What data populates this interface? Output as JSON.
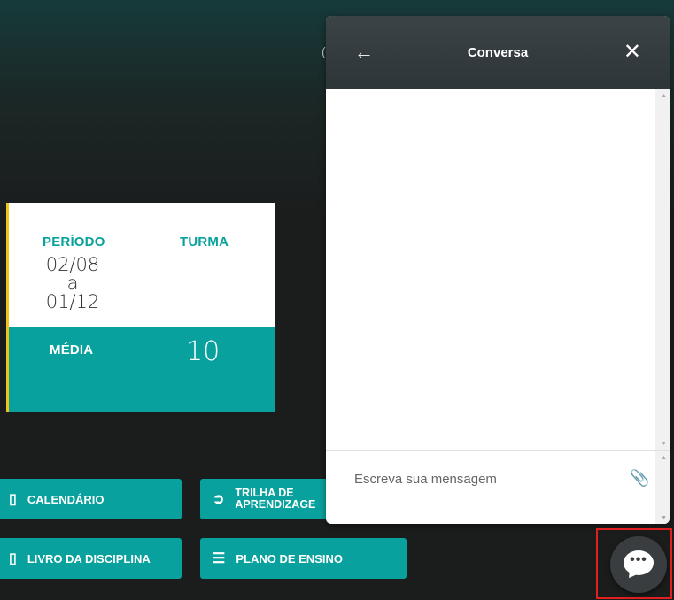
{
  "background_partial_char": "(",
  "card": {
    "periodo_label": "PERÍODO",
    "periodo_value_line1": "02/08 a",
    "periodo_value_line2": "01/12",
    "turma_label": "TURMA",
    "media_label": "MÉDIA",
    "media_value": "10"
  },
  "buttons": {
    "calendario": "CALENDÁRIO",
    "trilha_line1": "TRILHA DE",
    "trilha_line2": "APRENDIZAGE",
    "livro": "LIVRO DA DISCIPLINA",
    "plano": "PLANO DE ENSINO"
  },
  "chat": {
    "title": "Conversa",
    "back_icon": "arrow-left-icon",
    "close_icon": "close-icon",
    "input_placeholder": "Escreva sua mensagem",
    "attach_icon": "paperclip-icon"
  },
  "fab": {
    "icon": "chat-bubble-icon"
  },
  "colors": {
    "accent": "#08a19d",
    "highlight": "#f0c419",
    "fab_outline": "#e02020"
  }
}
